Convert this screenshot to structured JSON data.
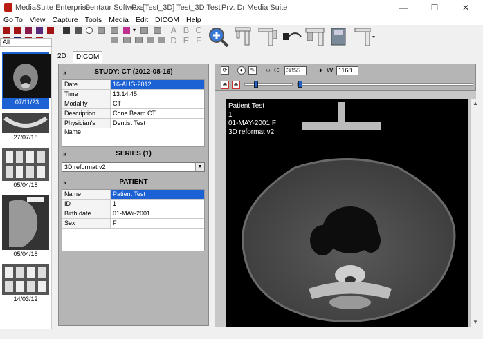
{
  "window": {
    "app_name": "MediaSuite Enterprise",
    "vendor": "Centaur Software",
    "patient_info": "Px:[Test_3D] Test_3D Test",
    "provider_info": "Prv: Dr Media Suite",
    "minimize": "—",
    "maximize": "☐",
    "close": "✕"
  },
  "menu": [
    "Go To",
    "View",
    "Capture",
    "Tools",
    "Media",
    "Edit",
    "DICOM",
    "Help"
  ],
  "toolbar": {
    "letters_top": [
      "A",
      "B",
      "C"
    ],
    "letters_bottom": [
      "D",
      "E",
      "F"
    ]
  },
  "filter_value": "All",
  "thumbnails": [
    {
      "date": "07/11/23",
      "selected": true
    },
    {
      "date": "27/07/18",
      "selected": false
    },
    {
      "date": "05/04/18",
      "selected": false
    },
    {
      "date": "05/04/18",
      "selected": false
    },
    {
      "date": "14/03/12",
      "selected": false
    }
  ],
  "tabs": [
    {
      "label": "2D"
    },
    {
      "label": "DICOM",
      "active": true
    }
  ],
  "study": {
    "header": "STUDY: CT (2012-08-16)",
    "rows": [
      {
        "key": "Date",
        "value": "16-AUG-2012",
        "selected": true
      },
      {
        "key": "Time",
        "value": "13:14:45"
      },
      {
        "key": "Modality",
        "value": "CT"
      },
      {
        "key": "Description",
        "value": "Cone Beam CT"
      },
      {
        "key": "Physician's Name",
        "value": "Dentist Test"
      }
    ]
  },
  "series": {
    "header": "SERIES (1)",
    "selected": "3D reformat v2"
  },
  "patient": {
    "header": "PATIENT",
    "rows": [
      {
        "key": "Name",
        "value": "Patient Test",
        "selected": true
      },
      {
        "key": "ID",
        "value": "1"
      },
      {
        "key": "Birth date",
        "value": "01-MAY-2001"
      },
      {
        "key": "Sex",
        "value": "F"
      }
    ]
  },
  "viewer": {
    "center_label": "C",
    "center_value": "3855",
    "width_label": "W",
    "width_value": "1168",
    "overlay": [
      "Patient Test",
      "1",
      "01-MAY-2001 F",
      "3D reformat v2"
    ]
  },
  "colors": {
    "selection": "#1c62d4",
    "panel": "#b5b5b5"
  }
}
